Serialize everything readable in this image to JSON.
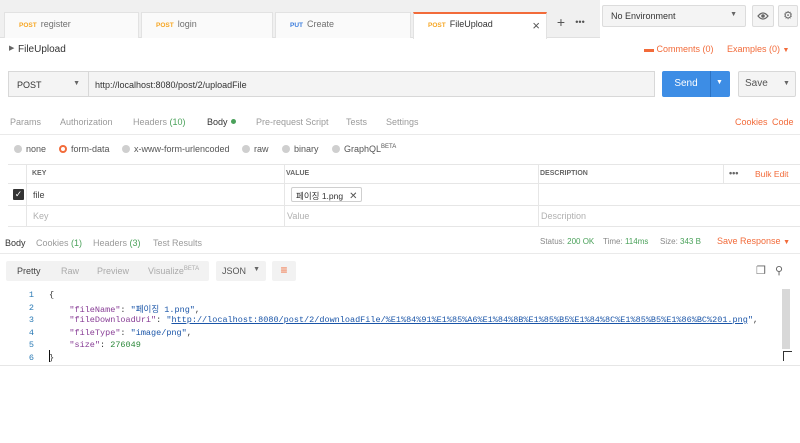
{
  "tabs": [
    {
      "method": "POST",
      "name": "register"
    },
    {
      "method": "POST",
      "name": "login"
    },
    {
      "method": "PUT",
      "name": "Create"
    },
    {
      "method": "POST",
      "name": "FileUpload"
    }
  ],
  "tab_actions": {
    "close": "×",
    "add": "+",
    "more": "•••"
  },
  "environment": {
    "selected": "No Environment"
  },
  "request": {
    "title": "FileUpload",
    "comments_label": "Comments (0)",
    "examples_label": "Examples (0)",
    "method": "POST",
    "url": "http://localhost:8080/post/2/uploadFile",
    "send_label": "Send",
    "save_label": "Save"
  },
  "request_tabs": {
    "params": "Params",
    "authorization": "Authorization",
    "headers": "Headers",
    "headers_count": "(10)",
    "body": "Body",
    "pre_request": "Pre-request Script",
    "tests": "Tests",
    "settings": "Settings",
    "cookies": "Cookies",
    "code": "Code"
  },
  "body_types": {
    "none": "none",
    "form_data": "form-data",
    "urlencoded": "x-www-form-urlencoded",
    "raw": "raw",
    "binary": "binary",
    "graphql": "GraphQL",
    "graphql_badge": "BETA"
  },
  "params_table": {
    "headers": {
      "key": "KEY",
      "value": "VALUE",
      "description": "DESCRIPTION"
    },
    "more": "•••",
    "bulk_edit": "Bulk Edit",
    "rows": [
      {
        "key": "file",
        "value": "페이징 1.png",
        "checked": true
      }
    ],
    "placeholders": {
      "key": "Key",
      "value": "Value",
      "description": "Description"
    }
  },
  "response_tabs": {
    "body": "Body",
    "cookies": "Cookies",
    "cookies_count": "(1)",
    "headers": "Headers",
    "headers_count": "(3)",
    "test_results": "Test Results"
  },
  "response_status": {
    "status_label": "Status:",
    "status": "200 OK",
    "time_label": "Time:",
    "time": "114ms",
    "size_label": "Size:",
    "size": "343 B",
    "save_response": "Save Response"
  },
  "response_view": {
    "pretty": "Pretty",
    "raw": "Raw",
    "preview": "Preview",
    "visualize": "Visualize",
    "visualize_badge": "BETA",
    "format": "JSON"
  },
  "response_body": {
    "line_numbers": [
      "1",
      "2",
      "3",
      "4",
      "5",
      "6"
    ],
    "open_brace": "{",
    "close_brace": "}",
    "fields": [
      {
        "key": "\"fileName\"",
        "value": "\"페이징 1.png\""
      },
      {
        "key": "\"fileDownloadUri\"",
        "value": "http://localhost:8080/post/2/downloadFile/%E1%84%91%E1%85%A6%E1%84%8B%E1%85%B5%E1%84%8C%E1%85%B5%E1%86%BC%201.png"
      },
      {
        "key": "\"fileType\"",
        "value": "\"image/png\""
      },
      {
        "key": "\"size\"",
        "value": "276049"
      }
    ]
  },
  "colors": {
    "accent": "#f26b3a",
    "send": "#3d8de5",
    "success": "#4aa15a",
    "method_post": "#f6a623",
    "method_put": "#3b7ddd"
  }
}
